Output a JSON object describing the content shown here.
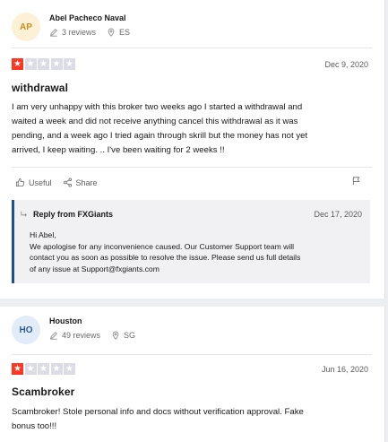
{
  "reviews": [
    {
      "avatar_initials": "AP",
      "name": "Abel Pacheco Naval",
      "review_count": "3 reviews",
      "country": "ES",
      "rating": 1,
      "date": "Dec 9, 2020",
      "title": "withdrawal",
      "text_lines": [
        "I am very unhappy with this broker two weeks ago I started a withdrawal and",
        "waited a week and did not receive anything cancel this withdrawal as it was",
        "pending, and a week ago I tried again through skrill but the money has not yet",
        "arrived, I keep waiting. .. I've been waiting for 2 weeks !!"
      ],
      "actions": {
        "useful_label": "Useful",
        "share_label": "Share"
      },
      "reply": {
        "heading": "Reply from FXGiants",
        "date": "Dec 17, 2020",
        "lines": [
          "Hi Abel,",
          "We apologise for any inconvenience caused. Our Customer Support team will",
          "contact you as soon as possible to resolve the issue. Please send us full details",
          "of any issue at Support@fxgiants.com"
        ]
      }
    },
    {
      "avatar_initials": "HO",
      "name": "Houston",
      "review_count": "49 reviews",
      "country": "SG",
      "rating": 1,
      "date": "Jun 16, 2020",
      "title": "Scambroker",
      "text_lines": [
        "Scambroker! Stole personal info and docs without verification approval. Fake",
        "bonus too!!!"
      ]
    }
  ],
  "colors": {
    "star_on": "#ff3722",
    "star_off": "#dcdce6",
    "reply_accent": "#1c4f8f"
  },
  "icons": {
    "review_count": "pencil-icon",
    "country": "location-pin-icon",
    "useful": "thumbs-up-icon",
    "share": "share-icon",
    "report": "flag-icon",
    "reply": "reply-arrow-icon",
    "star": "star-icon"
  }
}
